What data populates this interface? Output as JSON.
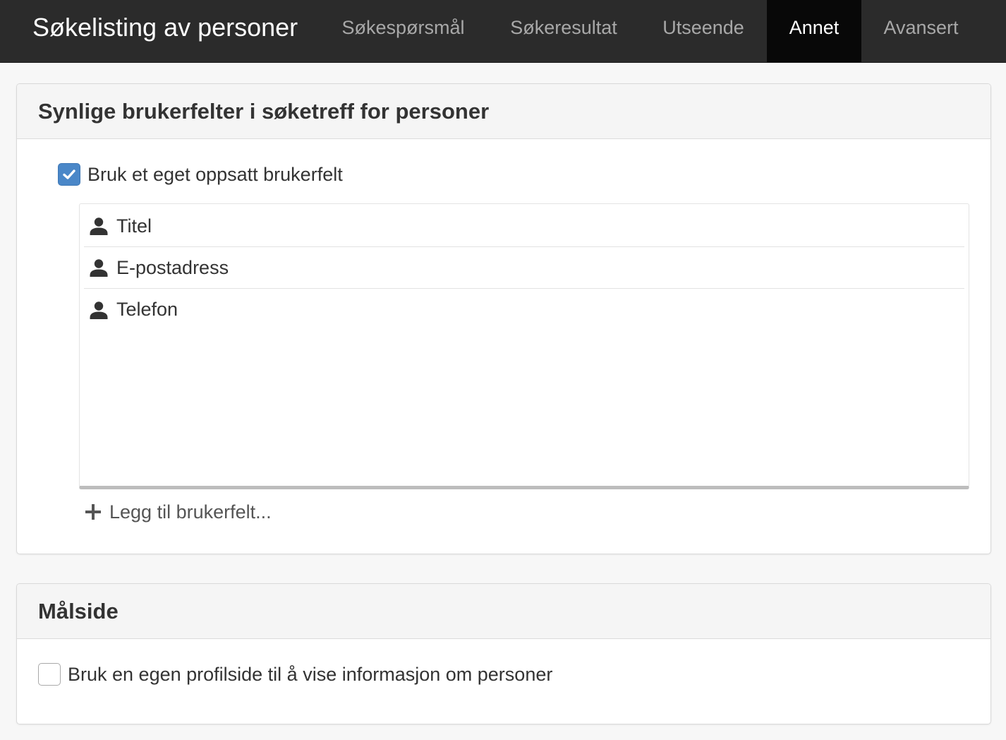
{
  "app": {
    "title": "Søkelisting av personer"
  },
  "nav": {
    "tabs": [
      {
        "label": "Søkespørsmål",
        "active": false
      },
      {
        "label": "Søkeresultat",
        "active": false
      },
      {
        "label": "Utseende",
        "active": false
      },
      {
        "label": "Annet",
        "active": true
      },
      {
        "label": "Avansert",
        "active": false
      }
    ]
  },
  "fields_panel": {
    "title": "Synlige brukerfelter i søketreff for personer",
    "custom_field_checkbox": {
      "label": "Bruk et eget oppsatt brukerfelt",
      "checked": true
    },
    "fields": [
      {
        "label": "Titel",
        "icon": "user-icon"
      },
      {
        "label": "E-postadress",
        "icon": "user-icon"
      },
      {
        "label": "Telefon",
        "icon": "user-icon"
      }
    ],
    "add_field_label": "Legg til brukerfelt...",
    "add_icon": "plus-icon"
  },
  "target_panel": {
    "title": "Målside",
    "profile_page_checkbox": {
      "label": "Bruk en egen profilside til å vise informasjon om personer",
      "checked": false
    }
  },
  "colors": {
    "topbar": "#2b2b2b",
    "active_tab": "#080808",
    "checkbox_accent": "#4a87c8"
  }
}
